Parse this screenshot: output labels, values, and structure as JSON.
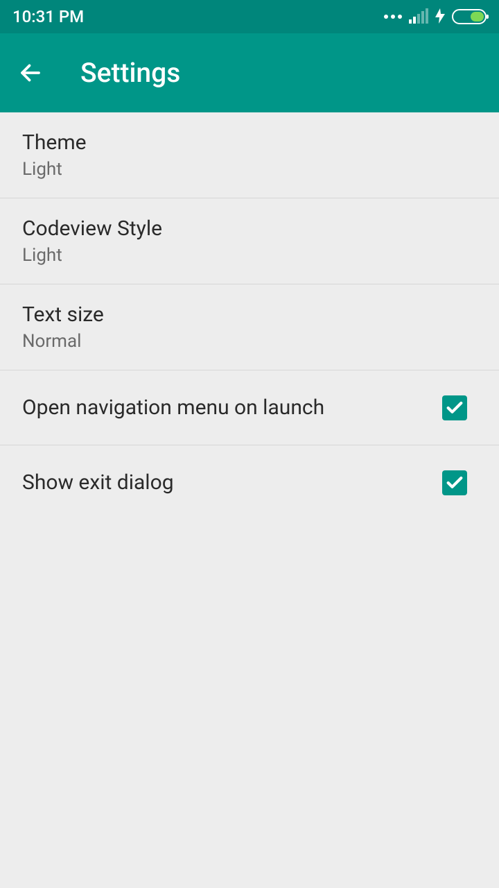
{
  "status": {
    "time": "10:31 PM"
  },
  "appbar": {
    "title": "Settings"
  },
  "settings": {
    "theme": {
      "title": "Theme",
      "value": "Light"
    },
    "codeview": {
      "title": "Codeview Style",
      "value": "Light"
    },
    "textsize": {
      "title": "Text size",
      "value": "Normal"
    },
    "openNav": {
      "title": "Open navigation menu on launch",
      "checked": true
    },
    "exitDialog": {
      "title": "Show exit dialog",
      "checked": true
    }
  }
}
